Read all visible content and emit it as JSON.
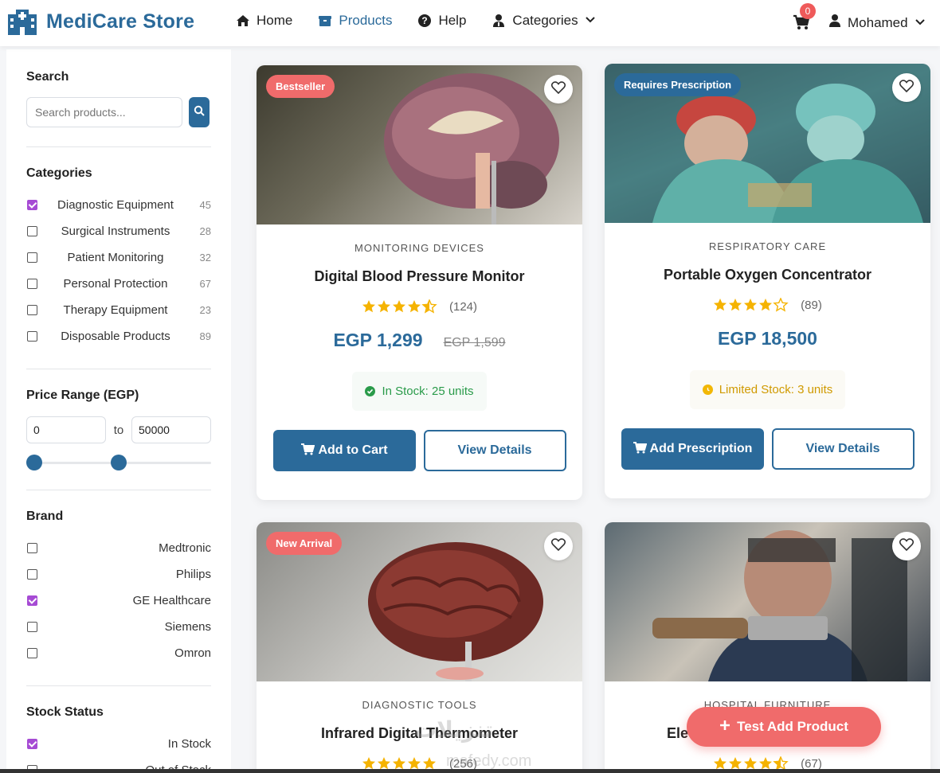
{
  "navbar": {
    "brand": "MediCare Store",
    "links": [
      {
        "label": "Home",
        "icon": "home-icon"
      },
      {
        "label": "Products",
        "icon": "box-icon",
        "active": true
      },
      {
        "label": "Help",
        "icon": "question-icon"
      },
      {
        "label": "Categories",
        "icon": "user-tie-icon"
      }
    ],
    "cart_count": "0",
    "user_name": "Mohamed"
  },
  "sidebar": {
    "search_title": "Search",
    "search_placeholder": "Search products...",
    "categories_title": "Categories",
    "categories": [
      {
        "label": "Diagnostic Equipment",
        "count": "45",
        "checked": true
      },
      {
        "label": "Surgical Instruments",
        "count": "28",
        "checked": false
      },
      {
        "label": "Patient Monitoring",
        "count": "32",
        "checked": false
      },
      {
        "label": "Personal Protection",
        "count": "67",
        "checked": false
      },
      {
        "label": "Therapy Equipment",
        "count": "23",
        "checked": false
      },
      {
        "label": "Disposable Products",
        "count": "89",
        "checked": false
      }
    ],
    "price_title": "Price Range (EGP)",
    "price_min": "0",
    "price_to": "to",
    "price_max": "50000",
    "brand_title": "Brand",
    "brands": [
      {
        "label": "Medtronic",
        "checked": false
      },
      {
        "label": "Philips",
        "checked": false
      },
      {
        "label": "GE Healthcare",
        "checked": true
      },
      {
        "label": "Siemens",
        "checked": false
      },
      {
        "label": "Omron",
        "checked": false
      }
    ],
    "stock_title": "Stock Status",
    "stock": [
      {
        "label": "In Stock",
        "checked": true
      },
      {
        "label": "Out of Stock",
        "checked": false
      }
    ]
  },
  "products": [
    {
      "badge": "Bestseller",
      "category": "MONITORING DEVICES",
      "name": "Digital Blood Pressure Monitor",
      "rating_count": "(124)",
      "price": "EGP 1,299",
      "old_price": "EGP 1,599",
      "stock": "In Stock: 25 units",
      "primary_btn": "Add to Cart",
      "secondary_btn": "View Details"
    },
    {
      "badge": "Requires Prescription",
      "category": "RESPIRATORY CARE",
      "name": "Portable Oxygen Concentrator",
      "rating_count": "(89)",
      "price": "EGP 18,500",
      "stock": "Limited Stock: 3 units",
      "primary_btn": "Add Prescription",
      "secondary_btn": "View Details"
    },
    {
      "badge": "New Arrival",
      "category": "DIAGNOSTIC TOOLS",
      "name": "Infrared Digital Thermometer",
      "rating_count": "(256)"
    },
    {
      "category": "HOSPITAL FURNITURE",
      "name": "Elec",
      "rating_count": "(67)"
    }
  ],
  "fab_label": "Test Add Product",
  "watermark": "تنزيلات",
  "watermark2": "mafedy.com",
  "colors": {
    "brand": "#2b6a9a",
    "accent": "#f06b6b",
    "check": "#a64bd4",
    "stars": "#f5b301"
  }
}
